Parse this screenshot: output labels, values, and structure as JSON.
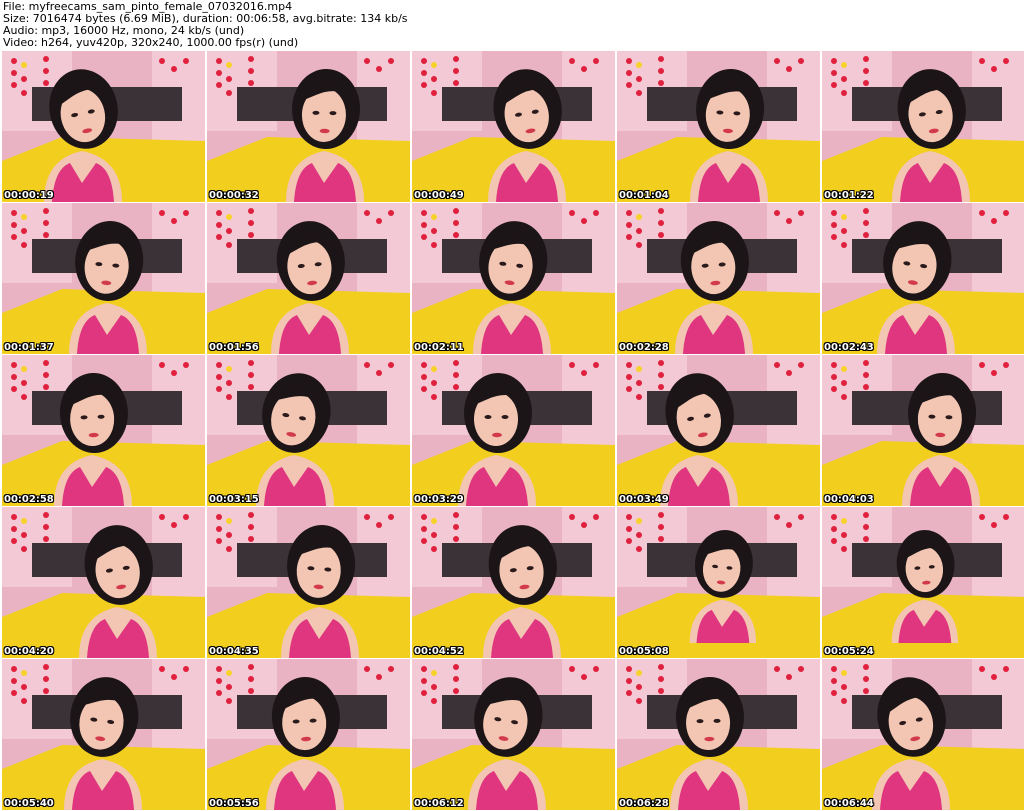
{
  "header": {
    "file_line": "File: myfreecams_sam_pinto_female_07032016.mp4",
    "size_line": "Size: 7016474 bytes (6.69 MiB), duration: 00:06:58, avg.bitrate: 134 kb/s",
    "audio_line": "Audio: mp3, 16000 Hz, mono, 24 kb/s (und)",
    "video_line": "Video: h264, yuv420p, 320x240, 1000.00 fps(r) (und)"
  },
  "thumbnails": [
    {
      "time": "00:00:19"
    },
    {
      "time": "00:00:32"
    },
    {
      "time": "00:00:49"
    },
    {
      "time": "00:01:04"
    },
    {
      "time": "00:01:22"
    },
    {
      "time": "00:01:37"
    },
    {
      "time": "00:01:56"
    },
    {
      "time": "00:02:11"
    },
    {
      "time": "00:02:28"
    },
    {
      "time": "00:02:43"
    },
    {
      "time": "00:02:58"
    },
    {
      "time": "00:03:15"
    },
    {
      "time": "00:03:29"
    },
    {
      "time": "00:03:49"
    },
    {
      "time": "00:04:03"
    },
    {
      "time": "00:04:20"
    },
    {
      "time": "00:04:35"
    },
    {
      "time": "00:04:52"
    },
    {
      "time": "00:05:08"
    },
    {
      "time": "00:05:24"
    },
    {
      "time": "00:05:40"
    },
    {
      "time": "00:05:56"
    },
    {
      "time": "00:06:12"
    },
    {
      "time": "00:06:28"
    },
    {
      "time": "00:06:44"
    }
  ],
  "colors": {
    "wall": "#e9b3c4",
    "curtain": "#f4c9d6",
    "headboard": "#3a3236",
    "bedding": "#f2cf1f",
    "skin": "#f2c6b2",
    "hair": "#1c1517",
    "top": "#e0357f",
    "hearts": "#e0213d"
  }
}
